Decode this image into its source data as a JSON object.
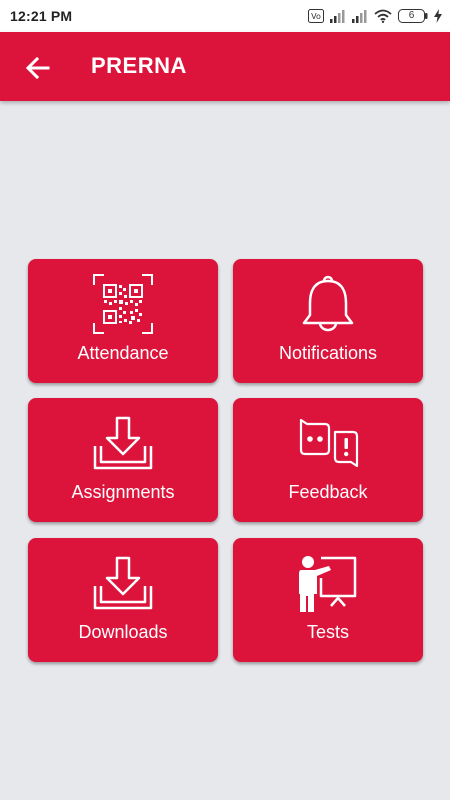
{
  "status_bar": {
    "time": "12:21 PM",
    "battery": "6"
  },
  "app_bar": {
    "title": "PRERNA",
    "back_icon": "arrow-left-icon"
  },
  "colors": {
    "primary": "#DC143C",
    "background": "#E6E8EC",
    "tile_text": "#FFFFFF"
  },
  "tiles": [
    {
      "label": "Attendance",
      "icon": "qr-code-icon"
    },
    {
      "label": "Notifications",
      "icon": "bell-icon"
    },
    {
      "label": "Assignments",
      "icon": "download-icon"
    },
    {
      "label": "Feedback",
      "icon": "chat-feedback-icon"
    },
    {
      "label": "Downloads",
      "icon": "download-icon"
    },
    {
      "label": "Tests",
      "icon": "teacher-board-icon"
    }
  ]
}
